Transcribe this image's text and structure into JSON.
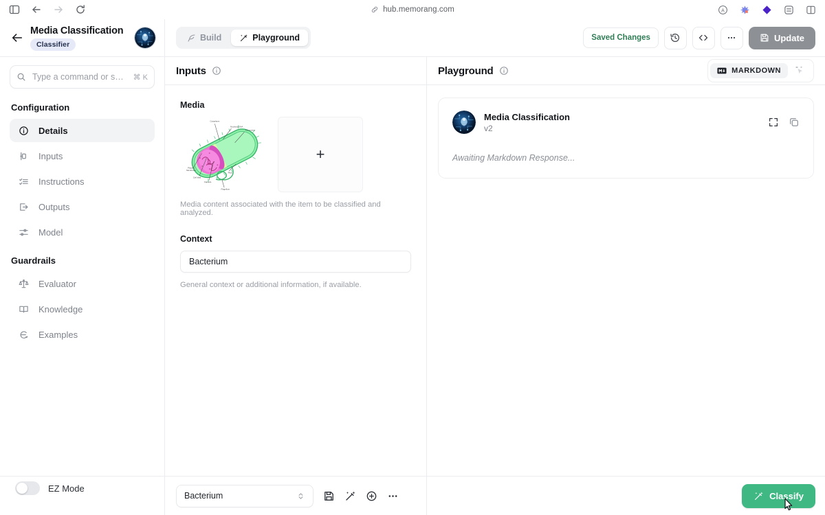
{
  "browser": {
    "url": "hub.memorang.com",
    "icons": {
      "sidebar_toggle": "panel-left-icon",
      "back": "back-arrow-icon",
      "forward": "forward-arrow-icon",
      "reload": "reload-icon",
      "link": "link-icon",
      "account": "account-circle-icon",
      "ext_1": "extension-puzzle-icon",
      "ext_2": "diamond-extension-icon",
      "ext_3": "reader-mode-icon",
      "panel": "split-view-icon"
    }
  },
  "header": {
    "back_label": "←",
    "title": "Media Classification",
    "badge": "Classifier",
    "avatar_name": "project-avatar",
    "tabs": [
      {
        "label": "Build",
        "icon": "feather-icon",
        "active": false
      },
      {
        "label": "Playground",
        "icon": "wand-icon",
        "active": true
      }
    ],
    "saved_changes": "Saved Changes",
    "history_icon": "history-clock-icon",
    "code_icon": "code-brackets-icon",
    "more_icon": "ellipsis-icon",
    "update_label": "Update",
    "update_icon": "save-disk-icon"
  },
  "sidebar": {
    "search": {
      "placeholder": "Type a command or s…",
      "shortcut": "⌘ K",
      "icon": "search-icon"
    },
    "sections": [
      {
        "title": "Configuration",
        "items": [
          {
            "label": "Details",
            "icon": "info-circle-icon",
            "active": true
          },
          {
            "label": "Inputs",
            "icon": "input-node-icon",
            "active": false
          },
          {
            "label": "Instructions",
            "icon": "checklist-icon",
            "active": false
          },
          {
            "label": "Outputs",
            "icon": "output-export-icon",
            "active": false
          },
          {
            "label": "Model",
            "icon": "sliders-icon",
            "active": false
          }
        ]
      },
      {
        "title": "Guardrails",
        "items": [
          {
            "label": "Evaluator",
            "icon": "scales-balance-icon",
            "active": false
          },
          {
            "label": "Knowledge",
            "icon": "open-book-icon",
            "active": false
          },
          {
            "label": "Examples",
            "icon": "examples-icon",
            "active": false
          }
        ]
      }
    ],
    "ez_mode": {
      "label": "EZ Mode",
      "enabled": false
    }
  },
  "inputs_panel": {
    "title": "Inputs",
    "info_icon": "info-circle-icon",
    "media": {
      "label": "Media",
      "thumb_alt": "bacterium-cell-diagram",
      "thumb_labels": [
        "Cytoplasm",
        "Nucleoid DNA",
        "Ribosomes",
        "Plasma Membrane",
        "Cell Wall",
        "Capsule",
        "Pilus",
        "Flagellum"
      ],
      "add_label": "+",
      "help": "Media content associated with the item to be classified and analyzed."
    },
    "context": {
      "label": "Context",
      "value": "Bacterium",
      "help": "General context or additional information, if available."
    }
  },
  "playground": {
    "title": "Playground",
    "info_icon": "info-circle-icon",
    "format_toggle": {
      "label": "MARKDOWN",
      "icon": "markdown-icon",
      "active": true
    },
    "sparkle_icon": "sparkle-cursor-icon",
    "card": {
      "avatar_name": "model-avatar",
      "name": "Media Classification",
      "version": "v2",
      "expand_icon": "expand-fullscreen-icon",
      "copy_icon": "copy-icon",
      "status": "Awaiting Markdown Response..."
    }
  },
  "bottom_bar": {
    "select_value": "Bacterium",
    "select_icon": "chevron-updown-icon",
    "actions": [
      {
        "icon": "save-disk-icon",
        "name": "save-button"
      },
      {
        "icon": "wand-magic-icon",
        "name": "generate-button"
      },
      {
        "icon": "plus-circle-icon",
        "name": "add-button"
      },
      {
        "icon": "ellipsis-icon",
        "name": "more-button"
      }
    ],
    "classify_label": "Classify",
    "classify_icon": "wand-magic-icon",
    "classify_color": "#3fb883"
  }
}
